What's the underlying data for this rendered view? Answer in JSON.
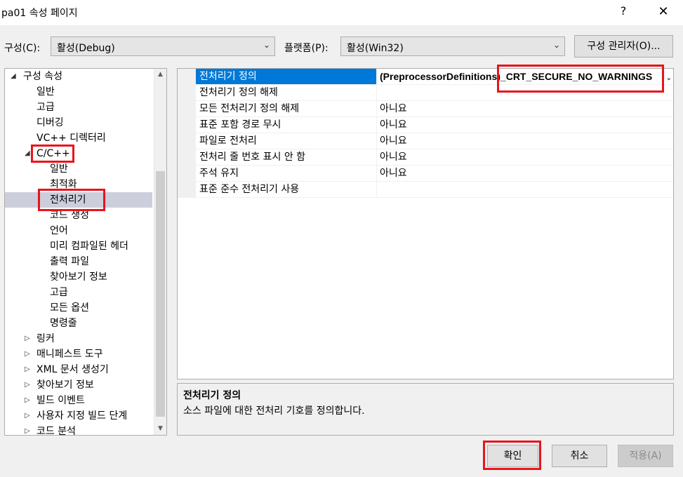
{
  "window": {
    "title": "pa01 속성 페이지",
    "help_label": "?",
    "close_label": "✕"
  },
  "config_bar": {
    "configuration_label": "구성(C):",
    "configuration_value": "활성(Debug)",
    "platform_label": "플랫폼(P):",
    "platform_value": "활성(Win32)",
    "config_manager_label": "구성 관리자(O)..."
  },
  "tree": {
    "items": [
      {
        "label": "구성 속성",
        "toggle": "◢"
      },
      {
        "label": "일반"
      },
      {
        "label": "고급"
      },
      {
        "label": "디버깅"
      },
      {
        "label": "VC++ 디렉터리"
      },
      {
        "label": "C/C++",
        "toggle": "◢"
      },
      {
        "label": "일반"
      },
      {
        "label": "최적화"
      },
      {
        "label": "전처리기"
      },
      {
        "label": "코드 생성"
      },
      {
        "label": "언어"
      },
      {
        "label": "미리 컴파일된 헤더"
      },
      {
        "label": "출력 파일"
      },
      {
        "label": "찾아보기 정보"
      },
      {
        "label": "고급"
      },
      {
        "label": "모든 옵션"
      },
      {
        "label": "명령줄"
      },
      {
        "label": "링커",
        "toggle": "▷"
      },
      {
        "label": "매니페스트 도구",
        "toggle": "▷"
      },
      {
        "label": "XML 문서 생성기",
        "toggle": "▷"
      },
      {
        "label": "찾아보기 정보",
        "toggle": "▷"
      },
      {
        "label": "빌드 이벤트",
        "toggle": "▷"
      },
      {
        "label": "사용자 지정 빌드 단계",
        "toggle": "▷"
      },
      {
        "label": "코드 분석",
        "toggle": "▷"
      }
    ]
  },
  "properties": {
    "rows": [
      {
        "name": "전처리기 정의",
        "value": "(PreprocessorDefinitions)_CRT_SECURE_NO_WARNINGS"
      },
      {
        "name": "전처리기 정의 해제",
        "value": ""
      },
      {
        "name": "모든 전처리기 정의 해제",
        "value": "아니요"
      },
      {
        "name": "표준 포함 경로 무시",
        "value": "아니요"
      },
      {
        "name": "파일로 전처리",
        "value": "아니요"
      },
      {
        "name": "전처리 줄 번호 표시 안 함",
        "value": "아니요"
      },
      {
        "name": "주석 유지",
        "value": "아니요"
      },
      {
        "name": "표준 준수 전처리기 사용",
        "value": ""
      }
    ]
  },
  "description": {
    "title": "전처리기 정의",
    "text": "소스 파일에 대한 전처리 기호를 정의합니다."
  },
  "buttons": {
    "ok": "확인",
    "cancel": "취소",
    "apply": "적용(A)"
  },
  "colors": {
    "highlight_red": "#e8141b",
    "selection_blue": "#0078d7",
    "tree_selection": "#cccedb"
  }
}
